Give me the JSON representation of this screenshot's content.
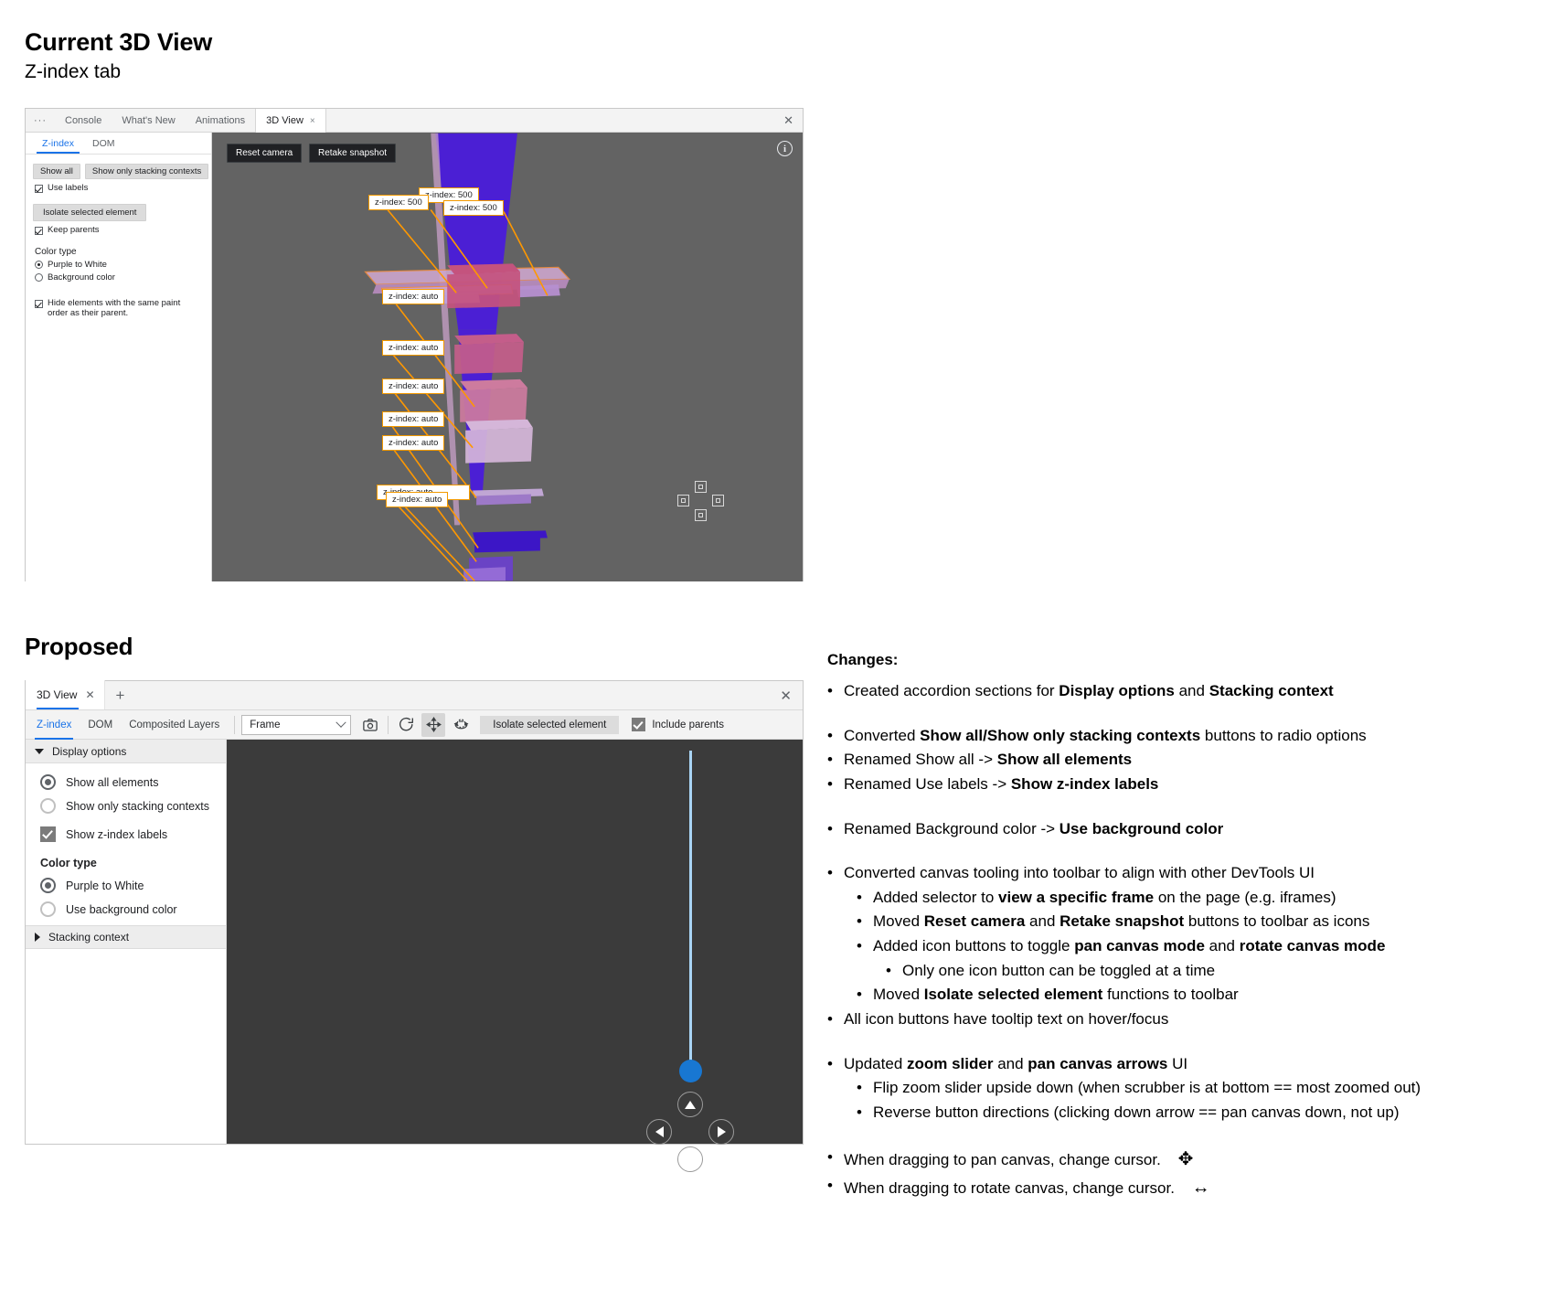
{
  "headings": {
    "current_title": "Current 3D View",
    "current_subtitle": "Z-index tab",
    "proposed_title": "Proposed"
  },
  "current_mock": {
    "tabbar": {
      "more_dots": "···",
      "tabs": [
        "Console",
        "What's New",
        "Animations",
        "3D View"
      ],
      "active_tab": "3D View",
      "tab_close": "×",
      "panel_close": "✕"
    },
    "subtabs": {
      "items": [
        "Z-index",
        "DOM"
      ],
      "active": "Z-index"
    },
    "sidebar": {
      "show_all_button": "Show all",
      "show_only_stacking_button": "Show only stacking contexts",
      "use_labels_label": "Use labels",
      "use_labels_checked": true,
      "isolate_button": "Isolate selected element",
      "keep_parents_label": "Keep parents",
      "keep_parents_checked": true,
      "color_type_heading": "Color type",
      "color_options": [
        {
          "label": "Purple to White",
          "selected": true
        },
        {
          "label": "Background color",
          "selected": false
        }
      ],
      "hide_same_paint_label": "Hide elements with the same paint order as their parent.",
      "hide_same_paint_checked": true
    },
    "canvas": {
      "reset_camera_button": "Reset camera",
      "retake_snapshot_button": "Retake snapshot",
      "info_icon": "i",
      "background_color": "#636363",
      "labels": [
        "z-index: 500",
        "z-index: 500",
        "z-index: 500",
        "z-index: auto",
        "z-index: auto",
        "z-index: auto",
        "z-index: auto",
        "z-index: auto",
        "z-index: auto",
        "z-index: auto"
      ],
      "slider_color": "#1a8cff",
      "slider_thumb_position": "top"
    }
  },
  "proposed_mock": {
    "tabbar": {
      "tab_label": "3D View",
      "tab_close": "✕",
      "new_tab": "+",
      "panel_close": "✕"
    },
    "toolbar": {
      "tabs": [
        "Z-index",
        "DOM",
        "Composited Layers"
      ],
      "active_tab": "Z-index",
      "frame_select_value": "Frame",
      "icons": [
        {
          "name": "retake-snapshot-icon",
          "toggled": false
        },
        {
          "name": "reset-camera-icon",
          "toggled": false
        },
        {
          "name": "pan-canvas-icon",
          "toggled": true
        },
        {
          "name": "rotate-canvas-icon",
          "toggled": false
        }
      ],
      "isolate_button": "Isolate selected element",
      "include_parents_label": "Include parents",
      "include_parents_checked": true
    },
    "sidebar": {
      "display_options_header": "Display options",
      "display_options_expanded": true,
      "radio_group": [
        {
          "label": "Show all elements",
          "selected": true
        },
        {
          "label": "Show only stacking contexts",
          "selected": false
        }
      ],
      "show_z_index_labels": "Show z-index labels",
      "show_z_index_labels_checked": true,
      "color_type_heading": "Color type",
      "color_options": [
        {
          "label": "Purple to White",
          "selected": true
        },
        {
          "label": "Use background color",
          "selected": false
        }
      ],
      "stacking_context_header": "Stacking context",
      "stacking_context_expanded": false
    },
    "canvas": {
      "background_color": "#3b3b3b",
      "slider_color": "#1877d2",
      "slider_track_color": "#a9d4f5",
      "slider_thumb_position": "bottom",
      "pan_arrows": [
        "up",
        "left",
        "right",
        "down"
      ]
    }
  },
  "changes": {
    "heading": "Changes:",
    "items": [
      {
        "level": 1,
        "html": "Created accordion sections for <b>Display options</b> and <b>Stacking context</b>"
      },
      {
        "level": 0,
        "html": ""
      },
      {
        "level": 1,
        "html": "Converted <b>Show all/Show only stacking contexts</b> buttons to radio options"
      },
      {
        "level": 1,
        "html": "Renamed Show all -> <b>Show all elements</b>"
      },
      {
        "level": 1,
        "html": "Renamed Use labels -> <b>Show z-index labels</b>"
      },
      {
        "level": 0,
        "html": ""
      },
      {
        "level": 1,
        "html": "Renamed Background color -> <b>Use background color</b>"
      },
      {
        "level": 0,
        "html": ""
      },
      {
        "level": 1,
        "html": "Converted canvas tooling into toolbar to align with other DevTools UI"
      },
      {
        "level": 2,
        "html": "Added selector to <b>view a specific frame</b> on the page (e.g. iframes)"
      },
      {
        "level": 2,
        "html": "Moved <b>Reset camera</b> and <b>Retake snapshot</b> buttons to toolbar as icons"
      },
      {
        "level": 2,
        "html": "Added icon buttons to toggle <b>pan canvas mode</b> and <b>rotate canvas mode</b>"
      },
      {
        "level": 3,
        "html": "Only one icon button can be toggled at a time"
      },
      {
        "level": 2,
        "html": "Moved <b>Isolate selected element</b> functions to toolbar"
      },
      {
        "level": 1,
        "html": "All icon buttons have tooltip text on hover/focus"
      },
      {
        "level": 0,
        "html": ""
      },
      {
        "level": 1,
        "html": "Updated <b>zoom slider</b> and <b>pan canvas arrows</b> UI"
      },
      {
        "level": 2,
        "html": "Flip zoom slider upside down (when scrubber is at bottom == most zoomed out)"
      },
      {
        "level": 2,
        "html": "Reverse button directions (clicking down arrow == pan canvas down, not up)"
      },
      {
        "level": 0,
        "html": ""
      },
      {
        "level": 1,
        "html": "When dragging to pan canvas, change cursor. <span class=\"cursor-glyph\">✥</span>"
      },
      {
        "level": 1,
        "html": "When dragging to rotate canvas, change cursor. <span class=\"cursor-glyph\">↔</span>"
      }
    ],
    "bullet_glyph": "•"
  }
}
